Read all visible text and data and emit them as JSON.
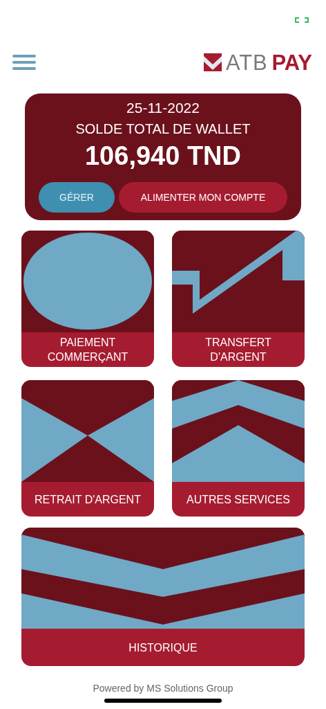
{
  "header": {
    "logo_text": "ATB",
    "logo_accent": "PAY"
  },
  "balance_card": {
    "date": "25-11-2022",
    "title": "SOLDE TOTAL DE WALLET",
    "amount": "106,940 TND",
    "buttons": [
      {
        "label": "GÉRER",
        "kind": "secondary"
      },
      {
        "label": "ALIMENTER MON COMPTE",
        "kind": "primary"
      }
    ]
  },
  "tiles": [
    {
      "label": "PAIEMENT COMMERÇANT",
      "kind": "circle"
    },
    {
      "label": "TRANSFERT D'ARGENT",
      "kind": "arrow"
    },
    {
      "label": "RETRAIT D'ARGENT",
      "kind": "hourglass"
    },
    {
      "label": "AUTRES SERVICES",
      "kind": "chevrons"
    },
    {
      "label": "HISTORIQUE",
      "kind": "wide"
    }
  ],
  "footer": {
    "text": "Powered by MS Solutions Group"
  }
}
